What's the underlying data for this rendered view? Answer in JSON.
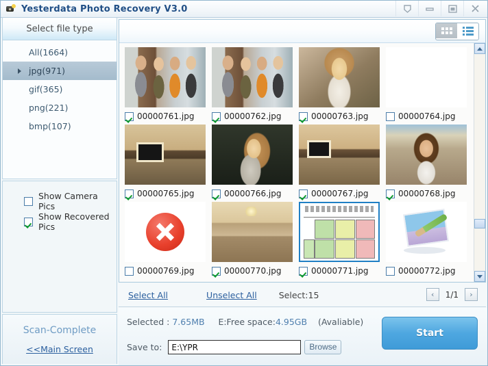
{
  "window": {
    "title": "Yesterdata Photo Recovery V3.0",
    "icon": "camera-icon",
    "buttons": [
      {
        "name": "help-button",
        "icon": "shield-icon"
      },
      {
        "name": "minimize-button",
        "icon": "minimize-icon"
      },
      {
        "name": "maximize-button",
        "icon": "maximize-icon"
      },
      {
        "name": "close-button",
        "icon": "close-icon"
      }
    ]
  },
  "sidebar": {
    "header": "Select file type",
    "file_types": [
      {
        "label": "All(1664)",
        "selected": false
      },
      {
        "label": "jpg(971)",
        "selected": true
      },
      {
        "label": "gif(365)",
        "selected": false
      },
      {
        "label": "png(221)",
        "selected": false
      },
      {
        "label": "bmp(107)",
        "selected": false
      }
    ],
    "options": [
      {
        "label": "Show Camera Pics",
        "checked": false
      },
      {
        "label": "Show Recovered Pics",
        "checked": true
      }
    ],
    "scan_status": "Scan-Complete",
    "main_screen_link": "<<Main Screen"
  },
  "toolbar": {
    "grid_view": {
      "icon": "grid-view-icon",
      "active": true
    },
    "list_view": {
      "icon": "list-view-icon",
      "active": false
    }
  },
  "thumbnails": [
    {
      "file": "00000761.jpg",
      "checked": true,
      "selected": false,
      "art": "art-girls"
    },
    {
      "file": "00000762.jpg",
      "checked": true,
      "selected": false,
      "art": "art-girls"
    },
    {
      "file": "00000763.jpg",
      "checked": true,
      "selected": false,
      "art": "art-blonde"
    },
    {
      "file": "00000764.jpg",
      "checked": false,
      "selected": false,
      "art": "art-blank"
    },
    {
      "file": "00000765.jpg",
      "checked": true,
      "selected": false,
      "art": "art-room1"
    },
    {
      "file": "00000766.jpg",
      "checked": true,
      "selected": false,
      "art": "art-profile"
    },
    {
      "file": "00000767.jpg",
      "checked": true,
      "selected": false,
      "art": "art-room2"
    },
    {
      "file": "00000768.jpg",
      "checked": true,
      "selected": false,
      "art": "art-cafe"
    },
    {
      "file": "00000769.jpg",
      "checked": false,
      "selected": false,
      "art": "art-redicon"
    },
    {
      "file": "00000770.jpg",
      "checked": true,
      "selected": false,
      "art": "art-living"
    },
    {
      "file": "00000771.jpg",
      "checked": true,
      "selected": true,
      "art": "art-chart"
    },
    {
      "file": "00000772.jpg",
      "checked": false,
      "selected": false,
      "art": "art-paint"
    }
  ],
  "selectbar": {
    "select_all": "Select All",
    "unselect_all": "Unselect All",
    "select_count": "Select:15",
    "prev": "‹",
    "next": "›",
    "page": "1/1"
  },
  "footer": {
    "selected_label": "Selected :",
    "selected_size": "7.65MB",
    "free_space_label": "E:Free space:",
    "free_space_value": "4.95GB",
    "availability": "(Avaliable)",
    "save_to_label": "Save to:",
    "save_to_value": "E:\\YPR",
    "save_to_placeholder": "E:\\YPR",
    "browse_label": "Browse",
    "start_label": "Start"
  },
  "colors": {
    "title_text": "#214f86",
    "accent_blue": "#4ea7e0",
    "link": "#2b5f9e",
    "check_green": "#0f9b2e",
    "selection_border": "#1f7fc4"
  }
}
